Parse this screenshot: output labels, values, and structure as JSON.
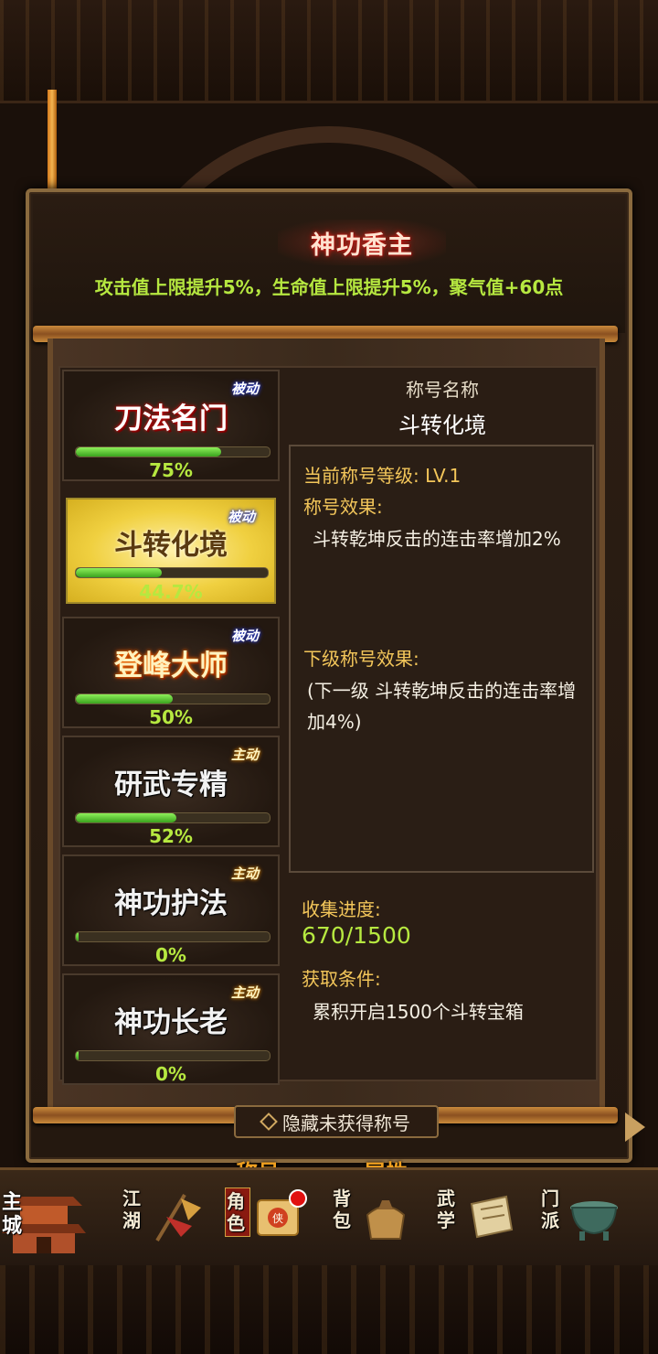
{
  "header": {
    "title": "神功香主",
    "bonus_text": "攻击值上限提升5%，生命值上限提升5%，聚气值+60点"
  },
  "titles": [
    {
      "name": "刀法名门",
      "tag": "被动",
      "progress": 75,
      "pct_label": "75%",
      "style": "red",
      "type": "passive"
    },
    {
      "name": "斗转化境",
      "tag": "被动",
      "progress": 44.7,
      "pct_label": "44.7%",
      "style": "gold",
      "type": "passive",
      "selected": true
    },
    {
      "name": "登峰大师",
      "tag": "被动",
      "progress": 50,
      "pct_label": "50%",
      "style": "orange",
      "type": "passive"
    },
    {
      "name": "研武专精",
      "tag": "主动",
      "progress": 52,
      "pct_label": "52%",
      "style": "silver",
      "type": "active"
    },
    {
      "name": "神功护法",
      "tag": "主动",
      "progress": 0,
      "pct_label": "0%",
      "style": "silver",
      "type": "active"
    },
    {
      "name": "神功长老",
      "tag": "主动",
      "progress": 0,
      "pct_label": "0%",
      "style": "silver",
      "type": "active"
    }
  ],
  "detail": {
    "name_label": "称号名称",
    "name_value": "斗转化境",
    "level_line": "当前称号等级: LV.1",
    "effect_label": "称号效果:",
    "effect_text": "斗转乾坤反击的连击率增加2%",
    "next_label": "下级称号效果:",
    "next_text": "(下一级 斗转乾坤反击的连击率增加4%)",
    "collect_label": "收集进度:",
    "collect_value": "670/1500",
    "condition_label": "获取条件:",
    "condition_text": "累积开启1500个斗转宝箱"
  },
  "hide_button": "隐藏未获得称号",
  "tabs": {
    "title_tab": "称号",
    "attr_tab": "属性"
  },
  "nav": [
    {
      "label": "主城",
      "icon": "palace-icon"
    },
    {
      "label": "江湖",
      "icon": "flag-icon"
    },
    {
      "label": "角色",
      "icon": "scroll-icon",
      "active": true,
      "badge": true
    },
    {
      "label": "背包",
      "icon": "bag-icon"
    },
    {
      "label": "武学",
      "icon": "book-icon"
    },
    {
      "label": "门派",
      "icon": "cauldron-icon"
    }
  ],
  "colors": {
    "accent_green": "#b6e840",
    "label_yellow": "#f3c65a",
    "frame": "#8a6a3e"
  }
}
